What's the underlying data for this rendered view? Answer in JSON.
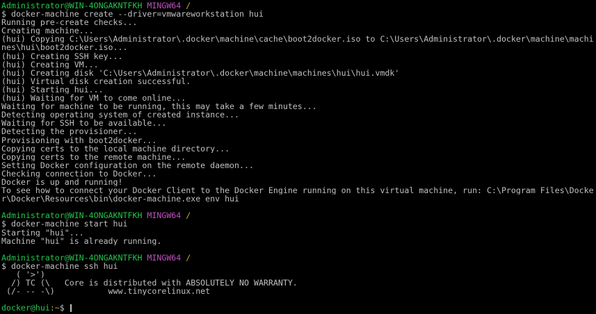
{
  "terminal": {
    "prompt": {
      "user_host": "Administrator@WIN-4ONGAKNTFKH",
      "shell": "MINGW64",
      "path": "/"
    },
    "commands": {
      "create": "$ docker-machine create --driver=vmwareworkstation hui",
      "start": "$ docker-machine start hui",
      "ssh": "$ docker-machine ssh hui"
    },
    "create_output": [
      "Running pre-create checks...",
      "Creating machine...",
      "(hui) Copying C:\\Users\\Administrator\\.docker\\machine\\cache\\boot2docker.iso to C:\\Users\\Administrator\\.docker\\machine\\machi",
      "nes\\hui\\boot2docker.iso...",
      "(hui) Creating SSH key...",
      "(hui) Creating VM...",
      "(hui) Creating disk 'C:\\Users\\Administrator\\.docker\\machine\\machines\\hui\\hui.vmdk'",
      "(hui) Virtual disk creation successful.",
      "(hui) Starting hui...",
      "(hui) Waiting for VM to come online...",
      "Waiting for machine to be running, this may take a few minutes...",
      "Detecting operating system of created instance...",
      "Waiting for SSH to be available...",
      "Detecting the provisioner...",
      "Provisioning with boot2docker...",
      "Copying certs to the local machine directory...",
      "Copying certs to the remote machine...",
      "Setting Docker configuration on the remote daemon...",
      "Checking connection to Docker...",
      "Docker is up and running!",
      "To see how to connect your Docker Client to the Docker Engine running on this virtual machine, run: C:\\Program Files\\Docke",
      "r\\Docker\\Resources\\bin\\docker-machine.exe env hui"
    ],
    "start_output": [
      "Starting \"hui\"...",
      "Machine \"hui\" is already running."
    ],
    "banner": [
      "   ( '>')",
      "  /) TC (\\   Core is distributed with ABSOLUTELY NO WARRANTY.",
      " (/-_--_-\\)           www.tinycorelinux.net"
    ],
    "remote_prompt": {
      "user_host": "docker@hui",
      "path": ":~",
      "symbol": "$"
    }
  }
}
